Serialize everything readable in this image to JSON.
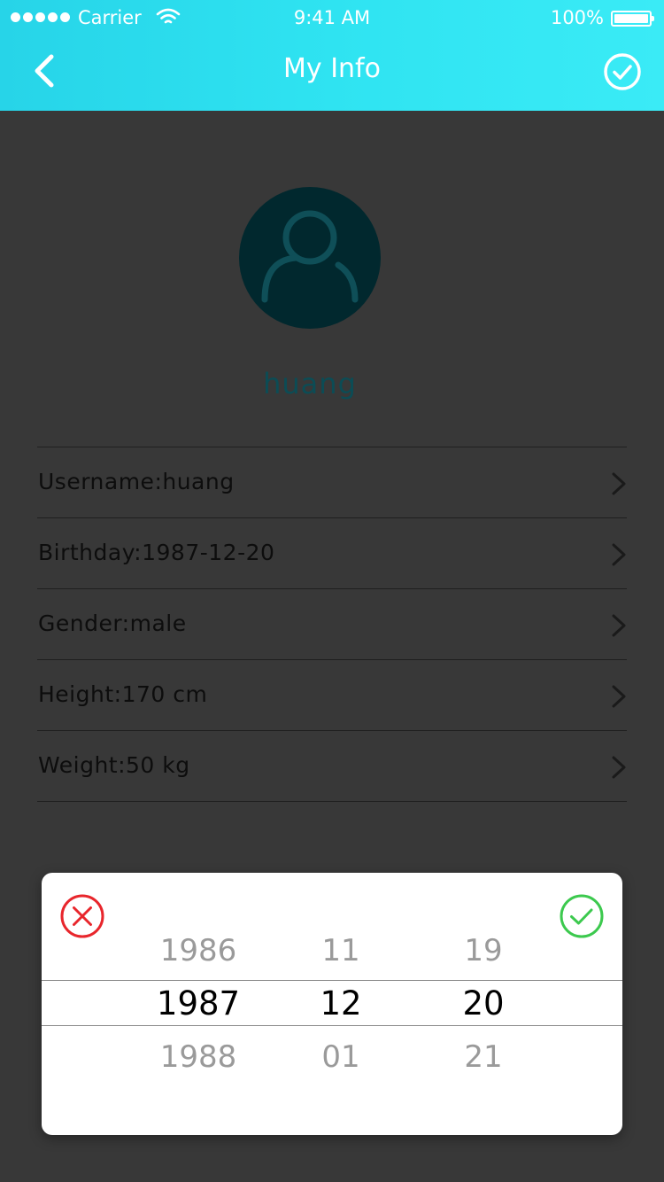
{
  "status_bar": {
    "carrier": "Carrier",
    "time": "9:41 AM",
    "battery": "100%",
    "battery_level": 1.0
  },
  "nav": {
    "title": "My Info",
    "back_icon": "chevron-left-icon",
    "done_icon": "check-circle-icon"
  },
  "profile": {
    "name": "huang",
    "avatar_icon": "user-icon"
  },
  "info_rows": [
    {
      "label": "Username:huang"
    },
    {
      "label": "Birthday:1987-12-20"
    },
    {
      "label": "Gender:male"
    },
    {
      "label": "Height:170 cm"
    },
    {
      "label": "Weight:50 kg"
    }
  ],
  "picker": {
    "cancel_icon": "x-circle-icon",
    "confirm_icon": "check-circle-icon",
    "year": [
      "1986",
      "1987",
      "1988"
    ],
    "month": [
      "11",
      "12",
      "01"
    ],
    "day": [
      "19",
      "20",
      "21"
    ]
  },
  "colors": {
    "header": "#2fe3f1",
    "background": "#383838",
    "avatar": "#01282e",
    "name": "#0c4c55",
    "cancel": "#e8262c",
    "confirm": "#3cc94e"
  }
}
